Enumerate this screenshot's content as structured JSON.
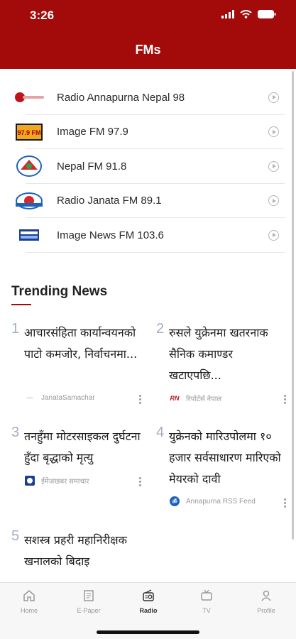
{
  "status_bar": {
    "time": "3:26"
  },
  "header": {
    "title": "FMs"
  },
  "fm_list": [
    {
      "name": "Radio Annapurna Nepal 98",
      "logo": "radio-annapurna-logo"
    },
    {
      "name": "Image FM 97.9",
      "logo": "image-fm-logo",
      "logo_text": "97.9 FM"
    },
    {
      "name": "Nepal FM 91.8",
      "logo": "nepal-fm-logo"
    },
    {
      "name": "Radio Janata FM 89.1",
      "logo": "radio-janata-logo"
    },
    {
      "name": "Image News FM 103.6",
      "logo": "image-news-fm-logo"
    }
  ],
  "trending": {
    "title": "Trending News",
    "items": [
      {
        "num": "1",
        "headline": "आचारसंहिता कार्यान्वयनको पाटो कमजोर, निर्वाचनमा...",
        "source": "JanataSamachar",
        "source_logo": "—"
      },
      {
        "num": "2",
        "headline": "रुसले युक्रेनमा खतरनाक सैनिक कमाण्डर खटाएपछि...",
        "source": "रिपोर्टर्स नेपाल",
        "source_logo": "RN"
      },
      {
        "num": "3",
        "headline": "तनहुँमा मोटरसाइकल दुर्घटना हुँदा बृद्धाको मृत्यु",
        "source": "ईमेजखबर समाचार",
        "source_logo": ""
      },
      {
        "num": "4",
        "headline": "युक्रेनको मारिउपोलमा १० हजार सर्वसाधारण मारिएको मेयरको दावी",
        "source": "Annapurna RSS Feed",
        "source_logo": ""
      },
      {
        "num": "5",
        "headline": "सशस्त्र प्रहरी महानिरीक्षक खनालको बिदाइ",
        "source": "",
        "source_logo": ""
      }
    ]
  },
  "tabs": [
    {
      "label": "Home",
      "icon": "home-icon"
    },
    {
      "label": "E-Paper",
      "icon": "epaper-icon"
    },
    {
      "label": "Radio",
      "icon": "radio-icon",
      "active": true
    },
    {
      "label": "TV",
      "icon": "tv-icon"
    },
    {
      "label": "Profile",
      "icon": "profile-icon"
    }
  ],
  "colors": {
    "brand": "#a30a0a",
    "number": "#a5aec6"
  }
}
